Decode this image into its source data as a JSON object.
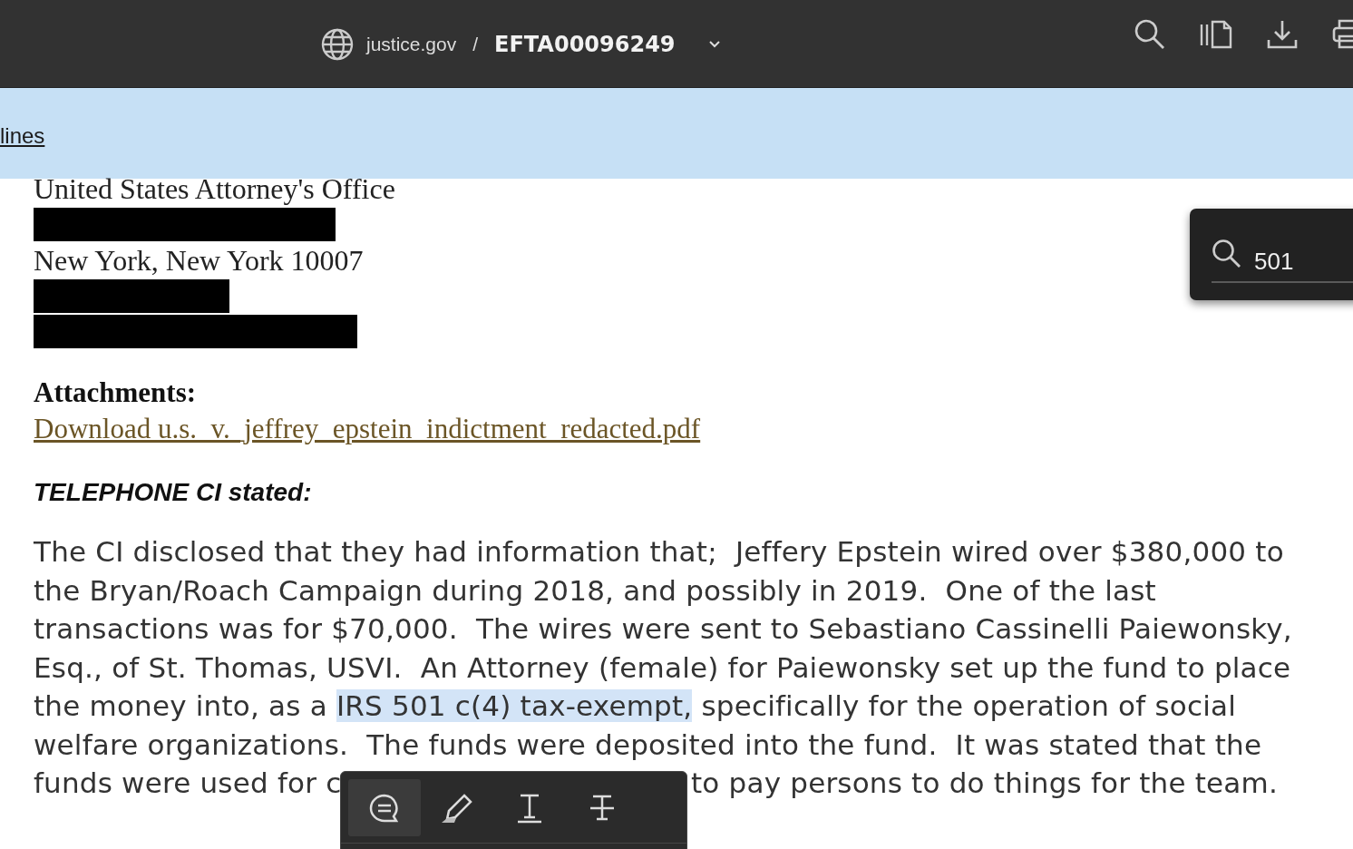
{
  "top_bar": {
    "site": "justice.gov",
    "separator": "/",
    "document": "EFTA00096249"
  },
  "banner": {
    "link": "lines"
  },
  "document": {
    "blocks": [
      {
        "kind": "text",
        "text": "United States Attorney's Office"
      },
      {
        "kind": "redaction"
      },
      {
        "kind": "text",
        "text": "New York, New York 10007"
      },
      {
        "kind": "redaction"
      },
      {
        "kind": "redaction"
      }
    ],
    "attachments_heading": "Attachments:",
    "attachment_link": "Download u.s._v._jeffrey_epstein_indictment_redacted.pdf",
    "section_heading": "TELEPHONE CI stated:",
    "paragraph": [
      [
        {
          "text": "The CI disclosed that they had information that;  Jeffery Epstein wired over $380,000 to",
          "highlighted": false
        }
      ],
      [
        {
          "text": "the Bryan/Roach Campaign during 2018, and possibly in 2019.  One of the last",
          "highlighted": false
        }
      ],
      [
        {
          "text": "transactions was for $70,000.  The wires were sent to Sebastiano Cassinelli Paiewonsky,",
          "highlighted": false
        }
      ],
      [
        {
          "text": "Esq., of St. Thomas, USVI.  An Attorney (female) for Paiewonsky set up the fund to place",
          "highlighted": false
        }
      ],
      [
        {
          "text": "the money into, as a ",
          "highlighted": false
        },
        {
          "text": "IRS 501 c(4) tax-exempt,",
          "highlighted": true
        },
        {
          "text": " specifically for the operation of social",
          "highlighted": false
        }
      ],
      [
        {
          "text": "welfare organizations.  The funds were deposited into the fund.  It was stated that the",
          "highlighted": false
        }
      ]
    ],
    "last_line_start": "funds were used for c",
    "last_line_end": "to pay persons to do things for the team."
  },
  "search_popup": {
    "value": "501"
  },
  "annotation_toolbar": {
    "tools": [
      {
        "kind": "comment",
        "selected": true
      },
      {
        "kind": "highlight",
        "selected": false
      },
      {
        "kind": "underline",
        "selected": false
      },
      {
        "kind": "strikethrough",
        "selected": false
      }
    ]
  }
}
